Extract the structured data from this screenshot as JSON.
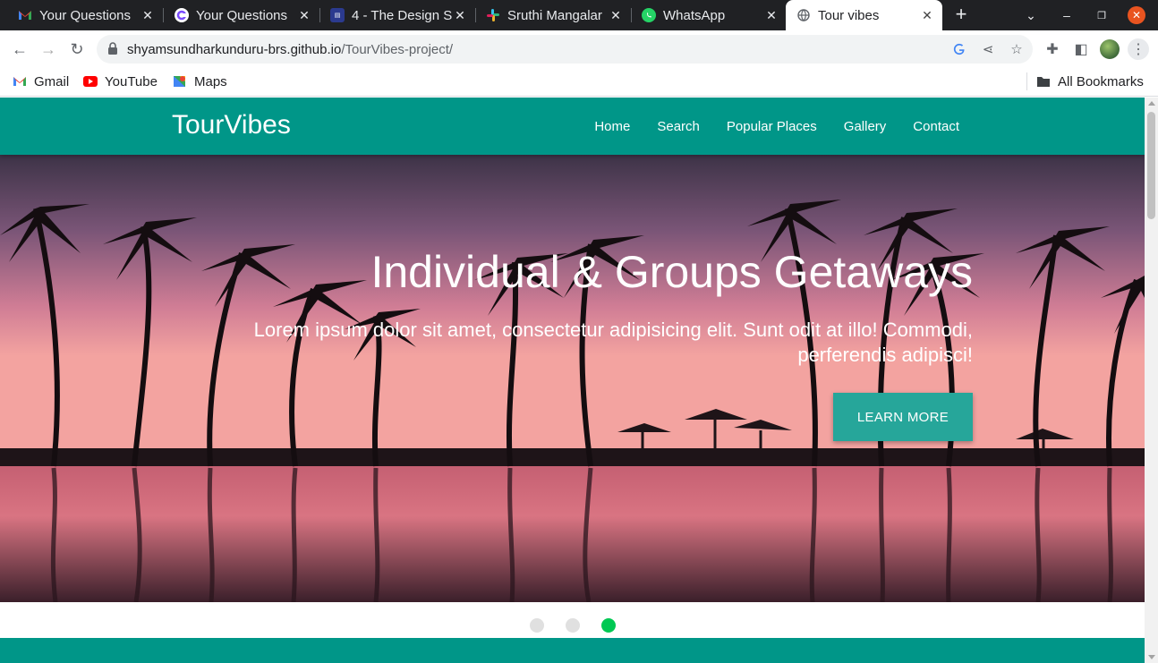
{
  "browser": {
    "tabs": [
      {
        "title": "Your Questions",
        "icon": "gmail-icon"
      },
      {
        "title": "Your Questions",
        "icon": "app-icon"
      },
      {
        "title": "4 - The Design Sy",
        "icon": "doc-icon"
      },
      {
        "title": "Sruthi Mangalar",
        "icon": "slack-icon"
      },
      {
        "title": "WhatsApp",
        "icon": "whatsapp-icon"
      },
      {
        "title": "Tour vibes",
        "icon": "globe-icon"
      }
    ],
    "active_tab": 5,
    "url_domain": "shyamsundharkunduru-brs.github.io",
    "url_path": "/TourVibes-project/",
    "bookmarks": [
      {
        "label": "Gmail",
        "icon": "gmail-icon"
      },
      {
        "label": "YouTube",
        "icon": "youtube-icon"
      },
      {
        "label": "Maps",
        "icon": "maps-icon"
      }
    ],
    "all_bookmarks": "All Bookmarks"
  },
  "site": {
    "brand": "TourVibes",
    "nav": [
      "Home",
      "Search",
      "Popular Places",
      "Gallery",
      "Contact"
    ],
    "hero": {
      "title": "Individual & Groups Getaways",
      "subtitle": "Lorem ipsum dolor sit amet, consectetur adipisicing elit. Sunt odit at illo! Commodi, perferendis adipisci!",
      "button": "LEARN MORE"
    },
    "slides": 3,
    "active_slide": 3
  },
  "colors": {
    "primary": "#009688",
    "button": "#26a69a",
    "indicator_active": "#00c853",
    "indicator_inactive": "#e0e0e0",
    "tabstrip": "#202124"
  }
}
